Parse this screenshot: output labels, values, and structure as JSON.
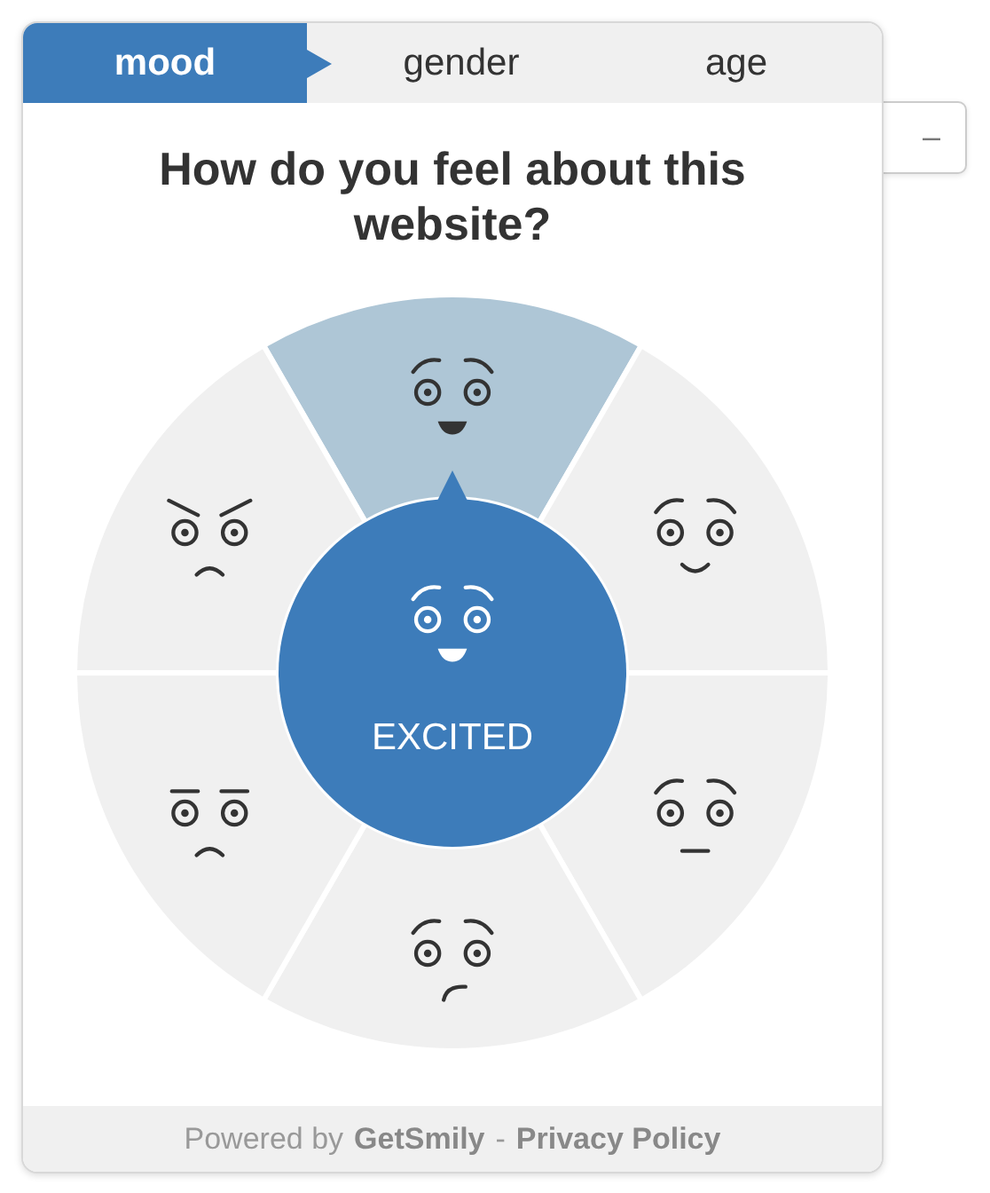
{
  "tabs": [
    {
      "label": "mood",
      "selected": true
    },
    {
      "label": "gender",
      "selected": false
    },
    {
      "label": "age",
      "selected": false
    }
  ],
  "minimize_button": "–",
  "question": "How do you feel about this website?",
  "moods": [
    {
      "kind": "excited",
      "selected": true
    },
    {
      "kind": "happy",
      "selected": false
    },
    {
      "kind": "neutral",
      "selected": false
    },
    {
      "kind": "skeptical",
      "selected": false
    },
    {
      "kind": "sad",
      "selected": false
    },
    {
      "kind": "angry",
      "selected": false
    }
  ],
  "selected_label": "EXCITED",
  "footer": {
    "prefix": "Powered by",
    "brand": "GetSmily",
    "separator": "-",
    "link": "Privacy Policy"
  }
}
